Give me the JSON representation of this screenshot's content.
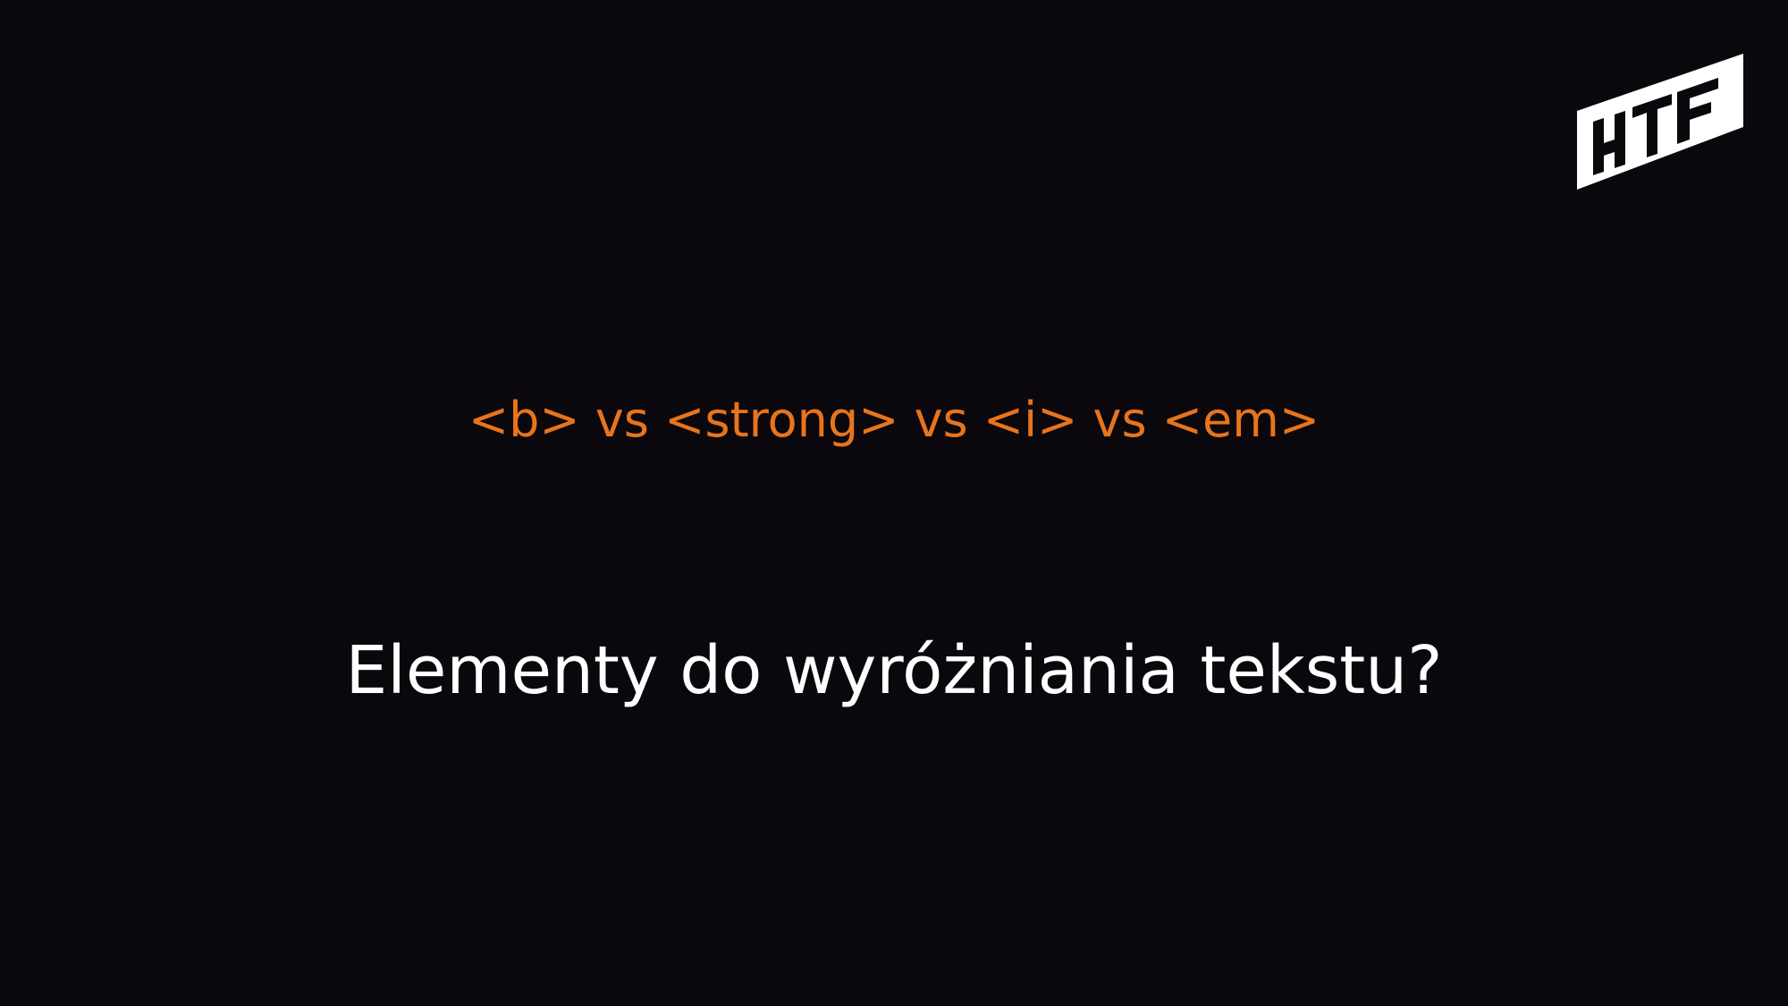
{
  "slide": {
    "subtitle": "<b> vs <strong> vs <i> vs <em>",
    "title": "Elementy do wyróżniania tekstu?",
    "logo_icon": "htf-logo-icon"
  },
  "colors": {
    "background": "#0a080c",
    "accent": "#e8741c",
    "text": "#ffffff"
  }
}
